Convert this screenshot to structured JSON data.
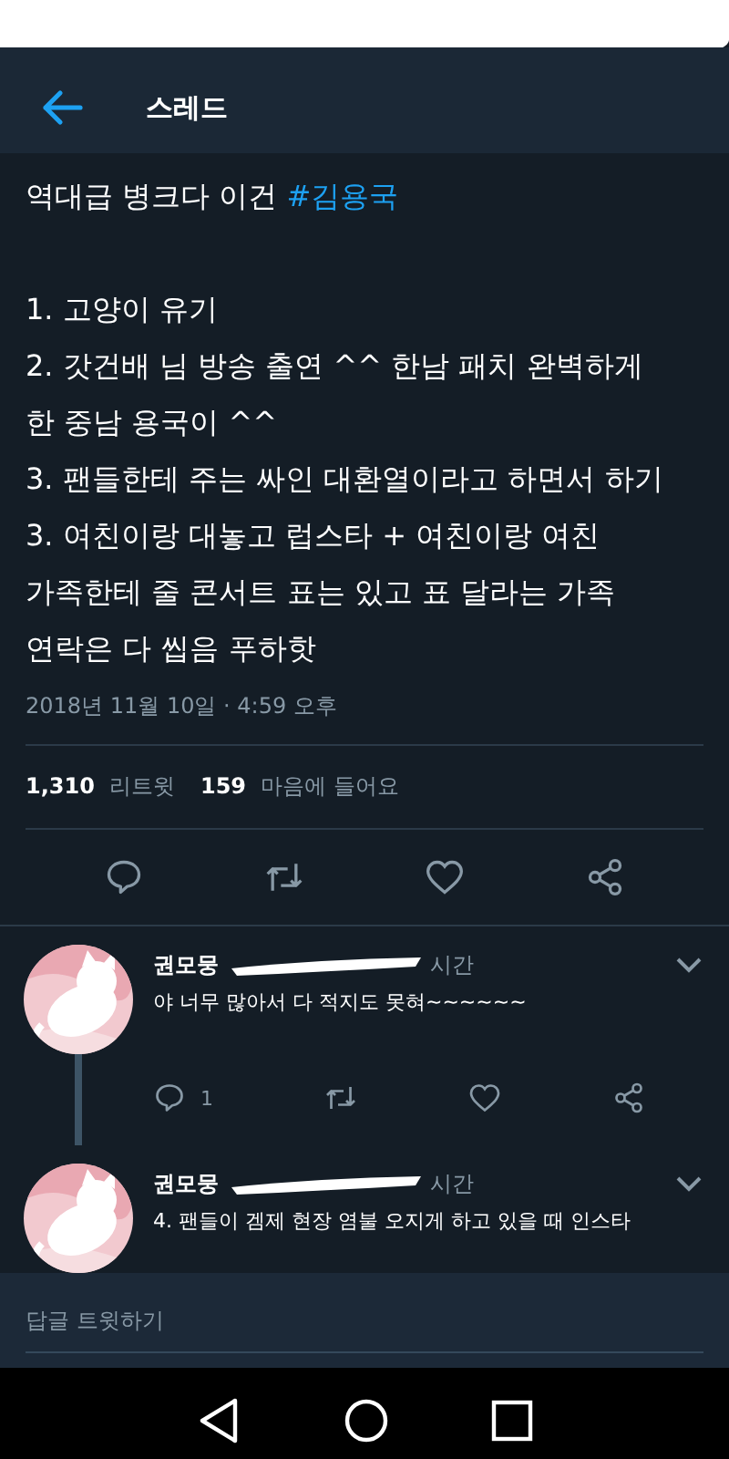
{
  "header": {
    "title": "스레드"
  },
  "tweet": {
    "headline": {
      "text": "역대급 병크다 이건 ",
      "hashtag": "#김용국"
    },
    "lines": [
      {
        "text": "1. 고양이 유기"
      },
      {
        "text": "2. 갓건배 님 방송 출연 ^^ 한남 패치 완벽하게"
      },
      {
        "text": "한 중남 용국이 ^^"
      },
      {
        "text": "3. 팬들한테 주는 싸인 대환열이라고 하면서 하기"
      },
      {
        "text": "3. 여친이랑 대놓고 럽스타 + 여친이랑 여친"
      },
      {
        "text": "가족한테 줄 콘서트 표는 있고 표 달라는 가족"
      },
      {
        "text": "연락은 다 씹음 푸하핫"
      }
    ],
    "timestamp": "2018년 11월 10일 · 4:59 오후",
    "retweets": {
      "count": "1,310",
      "label": "리트윗"
    },
    "likes": {
      "count": "159",
      "label": "마음에 들어요"
    }
  },
  "replies": [
    {
      "name": "권모뭉",
      "time": "시간",
      "text": "야 너무 많아서 다 적지도 못혀~~~~~~",
      "reply_count": "1",
      "thread": true,
      "actions": true
    },
    {
      "name": "권모뭉",
      "time": "시간",
      "text": "4. 팬들이 겜제 현장 염불 오지게 하고 있을 때 인스타",
      "thread": false,
      "actions": false
    }
  ],
  "compose": {
    "placeholder": "답글 트윗하기"
  }
}
